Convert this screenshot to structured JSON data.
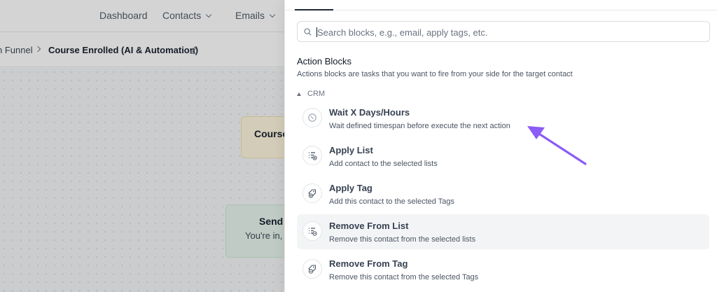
{
  "topnav": {
    "items": [
      {
        "label": "Dashboard"
      },
      {
        "label": "Contacts"
      },
      {
        "label": "Emails"
      }
    ]
  },
  "breadcrumb": {
    "parent": "n Funnel",
    "current": "Course Enrolled (AI & Automation)"
  },
  "canvas": {
    "trigger_node": {
      "title": "Course"
    },
    "email_node": {
      "title": "Send",
      "subtitle": "You're in, ("
    }
  },
  "drawer": {
    "search": {
      "placeholder": "Search blocks, e.g., email, apply tags, etc.",
      "value": ""
    },
    "section_title": "Action Blocks",
    "section_desc": "Actions blocks are tasks that you want to fire from your side for the target contact",
    "group": {
      "label": "CRM",
      "expanded": true
    },
    "blocks": [
      {
        "title": "Wait X Days/Hours",
        "desc": "Wait defined timespan before execute the next action",
        "icon": "clock-icon"
      },
      {
        "title": "Apply List",
        "desc": "Add contact to the selected lists",
        "icon": "list-add-icon"
      },
      {
        "title": "Apply Tag",
        "desc": "Add this contact to the selected Tags",
        "icon": "tag-add-icon"
      },
      {
        "title": "Remove From List",
        "desc": "Remove this contact from the selected lists",
        "icon": "list-remove-icon"
      },
      {
        "title": "Remove From Tag",
        "desc": "Remove this contact from the selected Tags",
        "icon": "tag-remove-icon"
      }
    ]
  },
  "annotation": {
    "icon": "pointer-arrow-icon",
    "color": "#8b5cf6"
  }
}
